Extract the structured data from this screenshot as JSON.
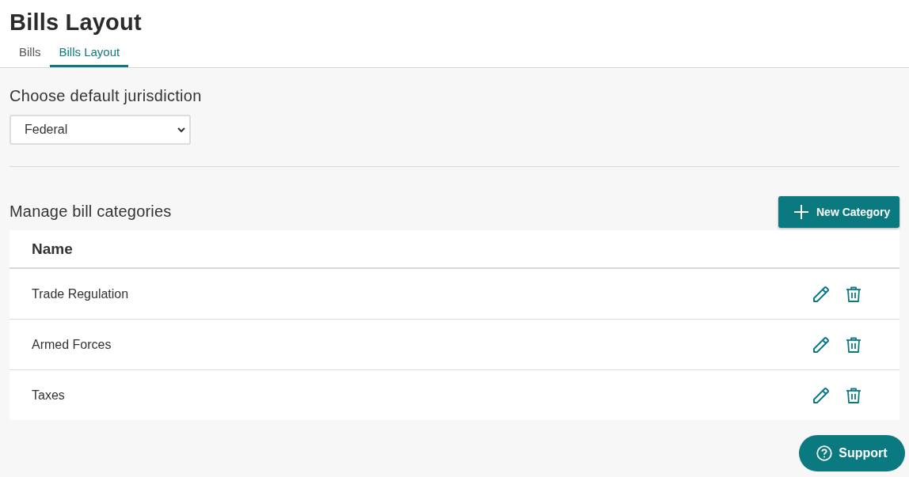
{
  "page": {
    "title": "Bills Layout"
  },
  "tabs": [
    {
      "label": "Bills",
      "selected": false
    },
    {
      "label": "Bills Layout",
      "selected": true
    }
  ],
  "jurisdiction": {
    "label": "Choose default jurisdiction",
    "value": "Federal"
  },
  "categories": {
    "heading": "Manage bill categories",
    "new_button": "New Category",
    "table": {
      "columns": [
        "Name"
      ],
      "rows": [
        {
          "name": "Trade Regulation"
        },
        {
          "name": "Armed Forces"
        },
        {
          "name": "Taxes"
        }
      ]
    }
  },
  "support_button": "Support"
}
